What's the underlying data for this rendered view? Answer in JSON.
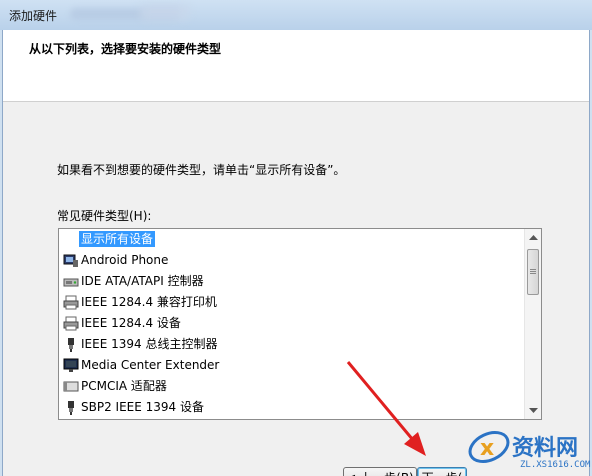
{
  "window": {
    "title": "添加硬件"
  },
  "header": {
    "title": "从以下列表，选择要安装的硬件类型"
  },
  "instruction": "如果看不到想要的硬件类型，请单击“显示所有设备”。",
  "list_label": "常见硬件类型(H):",
  "list": {
    "items": [
      {
        "label": "显示所有设备",
        "icon": "none",
        "selected": true
      },
      {
        "label": "Android Phone",
        "icon": "phone-device-icon",
        "selected": false
      },
      {
        "label": "IDE ATA/ATAPI 控制器",
        "icon": "disk-controller-icon",
        "selected": false
      },
      {
        "label": "IEEE 1284.4 兼容打印机",
        "icon": "printer-icon",
        "selected": false
      },
      {
        "label": "IEEE 1284.4 设备",
        "icon": "printer-icon",
        "selected": false
      },
      {
        "label": "IEEE 1394 总线主控制器",
        "icon": "plug-icon",
        "selected": false
      },
      {
        "label": "Media Center Extender",
        "icon": "monitor-icon",
        "selected": false
      },
      {
        "label": "PCMCIA 适配器",
        "icon": "pcmcia-card-icon",
        "selected": false
      },
      {
        "label": "SBP2 IEEE 1394 设备",
        "icon": "plug-icon",
        "selected": false
      }
    ]
  },
  "buttons": {
    "back": "< 上一步(B)",
    "next": "下一步("
  },
  "watermark": {
    "brand": "资料网",
    "url": "ZL.XS1616.COM"
  },
  "colors": {
    "selection": "#3399ff",
    "arrow": "#e02020",
    "watermark": "#2b73c5"
  }
}
